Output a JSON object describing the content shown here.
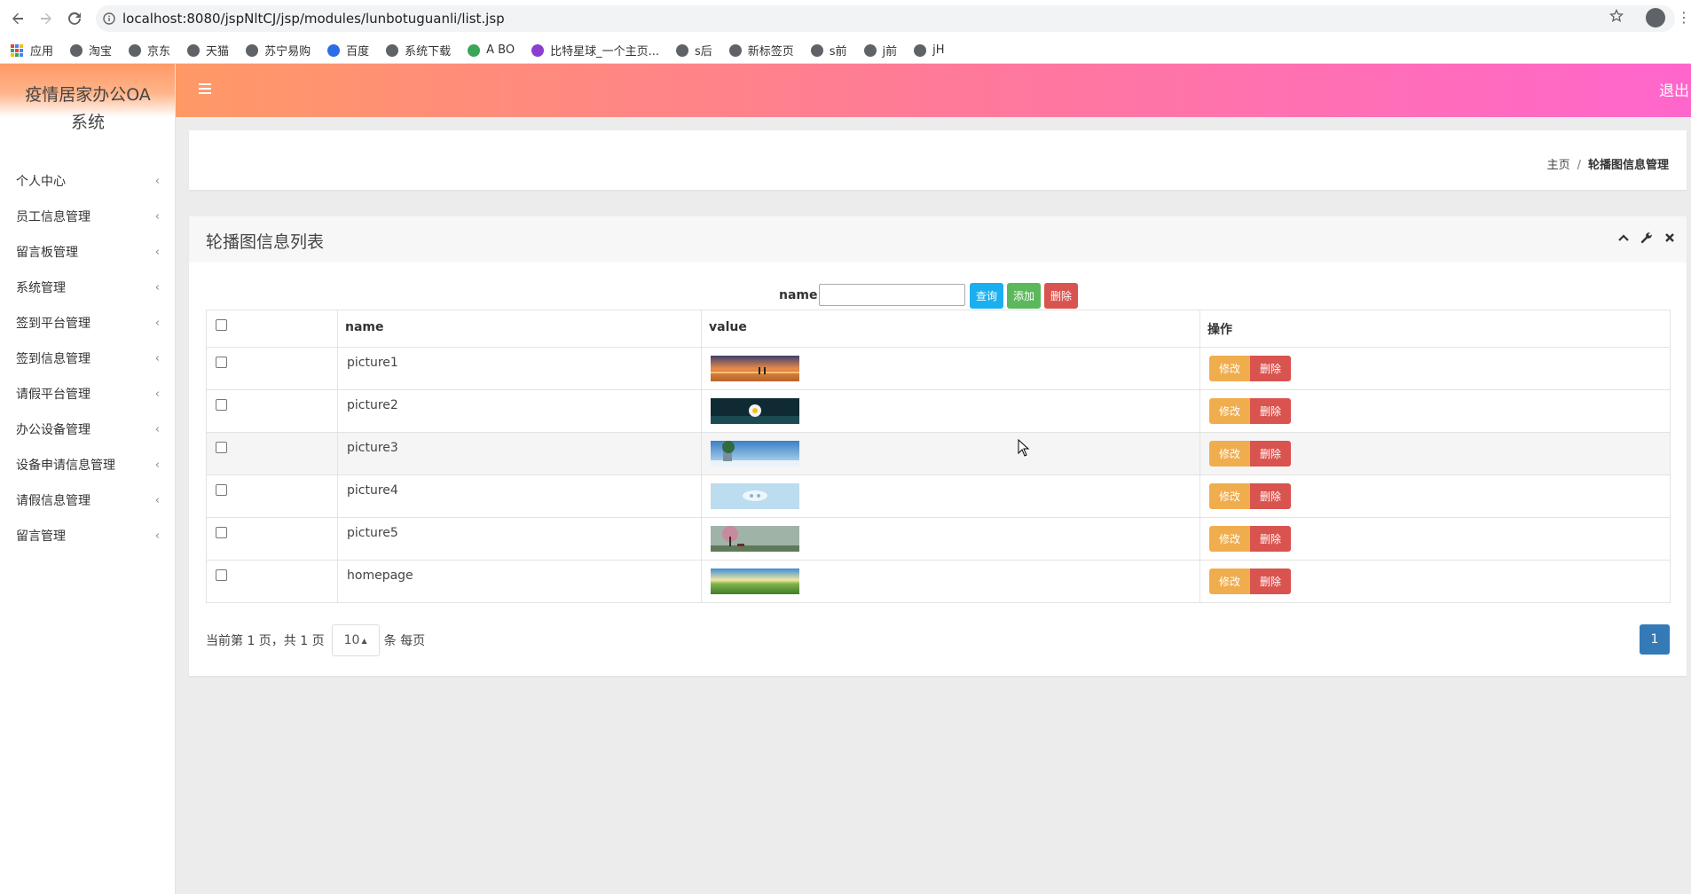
{
  "browser": {
    "url": "localhost:8080/jspNltCJ/jsp/modules/lunbotuguanli/list.jsp",
    "bookmarks": [
      "应用",
      "淘宝",
      "京东",
      "天猫",
      "苏宁易购",
      "百度",
      "系统下载",
      "A BO",
      "比特星球_一个主页...",
      "s后",
      "新标签页",
      "s前",
      "j前",
      "jH"
    ]
  },
  "brand": {
    "title_line1": "疫情居家办公OA",
    "title_line2": "系统"
  },
  "sidebar": {
    "items": [
      {
        "label": "个人中心"
      },
      {
        "label": "员工信息管理"
      },
      {
        "label": "留言板管理"
      },
      {
        "label": "系统管理"
      },
      {
        "label": "签到平台管理"
      },
      {
        "label": "签到信息管理"
      },
      {
        "label": "请假平台管理"
      },
      {
        "label": "办公设备管理"
      },
      {
        "label": "设备申请信息管理"
      },
      {
        "label": "请假信息管理"
      },
      {
        "label": "留言管理"
      }
    ],
    "chevron": "‹"
  },
  "header": {
    "logout": "退出"
  },
  "breadcrumb": {
    "home": "主页",
    "separator": "/",
    "current": "轮播图信息管理"
  },
  "panel": {
    "title": "轮播图信息列表",
    "search": {
      "label": "name",
      "value": "",
      "query_btn": "查询",
      "add_btn": "添加",
      "delete_btn": "删除"
    },
    "table": {
      "columns": [
        "name",
        "value",
        "操作"
      ],
      "rows": [
        {
          "name": "picture1",
          "thumb": "sunset"
        },
        {
          "name": "picture2",
          "thumb": "flower"
        },
        {
          "name": "picture3",
          "thumb": "beach"
        },
        {
          "name": "picture4",
          "thumb": "sky"
        },
        {
          "name": "picture5",
          "thumb": "tree"
        },
        {
          "name": "homepage",
          "thumb": "field"
        }
      ],
      "edit_label": "修改",
      "delete_label": "删除"
    },
    "pagination": {
      "prefix": "当前第 1 页，共 1 页",
      "page_size": "10",
      "suffix": "条 每页",
      "current_page": "1"
    }
  },
  "colors": {
    "header_gradient_start": "#ff9966",
    "header_gradient_end": "#ff66cc",
    "btn_query": "#1ab0f0",
    "btn_add": "#5cb85c",
    "btn_delete": "#d9534f",
    "btn_edit": "#f0ad4e",
    "page_active": "#337ab7"
  }
}
